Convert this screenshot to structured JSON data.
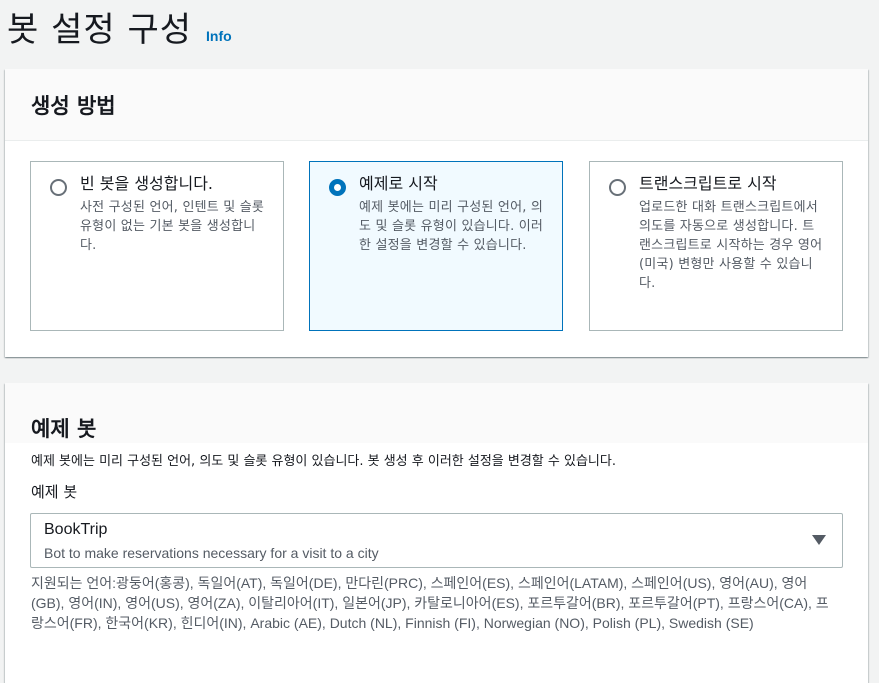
{
  "page": {
    "title": "봇 설정 구성",
    "info_link": "Info"
  },
  "creation_method": {
    "title": "생성 방법",
    "options": [
      {
        "label": "빈 봇을 생성합니다.",
        "description": "사전 구성된 언어, 인텐트 및 슬롯 유형이 없는 기본 봇을 생성합니다.",
        "selected": false
      },
      {
        "label": "예제로 시작",
        "description": "예제 봇에는 미리 구성된 언어, 의도 및 슬롯 유형이 있습니다. 이러한 설정을 변경할 수 있습니다.",
        "selected": true
      },
      {
        "label": "트랜스크립트로 시작",
        "description": "업로드한 대화 트랜스크립트에서 의도를 자동으로 생성합니다. 트랜스크립트로 시작하는 경우 영어(미국) 변형만 사용할 수 있습니다.",
        "selected": false
      }
    ]
  },
  "sample_bot": {
    "title": "예제 봇",
    "description": "예제 봇에는 미리 구성된 언어, 의도 및 슬롯 유형이 있습니다. 봇 생성 후 이러한 설정을 변경할 수 있습니다.",
    "field_label": "예제 봇",
    "selected_value": "BookTrip",
    "selected_description": "Bot to make reservations necessary for a visit to a city",
    "supported_languages": "지원되는 언어:광둥어(홍콩), 독일어(AT), 독일어(DE), 만다린(PRC), 스페인어(ES), 스페인어(LATAM), 스페인어(US), 영어(AU), 영어(GB), 영어(IN), 영어(US), 영어(ZA), 이탈리아어(IT), 일본어(JP), 카탈로니아어(ES), 포르투갈어(BR), 포르투갈어(PT), 프랑스어(CA), 프랑스어(FR), 한국어(KR), 힌디어(IN), Arabic (AE), Dutch (NL), Finnish (FI), Norwegian (NO), Polish (PL), Swedish (SE)"
  },
  "colors": {
    "accent": "#0073bb",
    "selected_tile_bg": "#f1faff"
  }
}
